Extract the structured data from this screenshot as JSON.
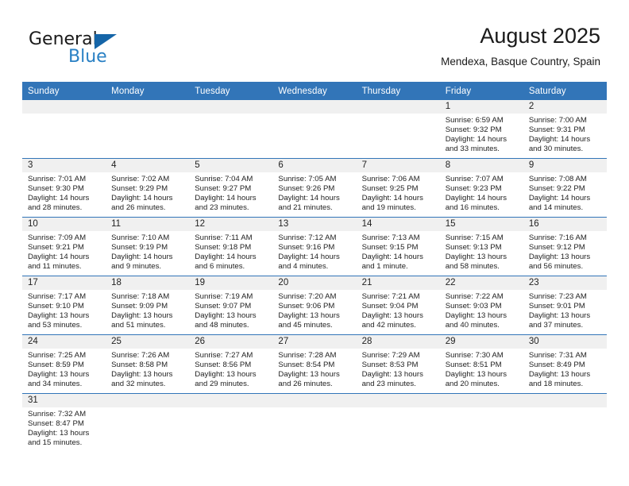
{
  "brand": {
    "name_part1": "General",
    "name_part2": "Blue"
  },
  "header": {
    "title": "August 2025",
    "subtitle": "Mendexa, Basque Country, Spain"
  },
  "calendar": {
    "weekday_headers": [
      "Sunday",
      "Monday",
      "Tuesday",
      "Wednesday",
      "Thursday",
      "Friday",
      "Saturday"
    ],
    "accent_color": "#3275b8",
    "daynum_bg": "#f0f0f0",
    "weeks": [
      [
        {
          "day": "",
          "sunrise": "",
          "sunset": "",
          "daylight_line1": "",
          "daylight_line2": ""
        },
        {
          "day": "",
          "sunrise": "",
          "sunset": "",
          "daylight_line1": "",
          "daylight_line2": ""
        },
        {
          "day": "",
          "sunrise": "",
          "sunset": "",
          "daylight_line1": "",
          "daylight_line2": ""
        },
        {
          "day": "",
          "sunrise": "",
          "sunset": "",
          "daylight_line1": "",
          "daylight_line2": ""
        },
        {
          "day": "",
          "sunrise": "",
          "sunset": "",
          "daylight_line1": "",
          "daylight_line2": ""
        },
        {
          "day": "1",
          "sunrise": "Sunrise: 6:59 AM",
          "sunset": "Sunset: 9:32 PM",
          "daylight_line1": "Daylight: 14 hours",
          "daylight_line2": "and 33 minutes."
        },
        {
          "day": "2",
          "sunrise": "Sunrise: 7:00 AM",
          "sunset": "Sunset: 9:31 PM",
          "daylight_line1": "Daylight: 14 hours",
          "daylight_line2": "and 30 minutes."
        }
      ],
      [
        {
          "day": "3",
          "sunrise": "Sunrise: 7:01 AM",
          "sunset": "Sunset: 9:30 PM",
          "daylight_line1": "Daylight: 14 hours",
          "daylight_line2": "and 28 minutes."
        },
        {
          "day": "4",
          "sunrise": "Sunrise: 7:02 AM",
          "sunset": "Sunset: 9:29 PM",
          "daylight_line1": "Daylight: 14 hours",
          "daylight_line2": "and 26 minutes."
        },
        {
          "day": "5",
          "sunrise": "Sunrise: 7:04 AM",
          "sunset": "Sunset: 9:27 PM",
          "daylight_line1": "Daylight: 14 hours",
          "daylight_line2": "and 23 minutes."
        },
        {
          "day": "6",
          "sunrise": "Sunrise: 7:05 AM",
          "sunset": "Sunset: 9:26 PM",
          "daylight_line1": "Daylight: 14 hours",
          "daylight_line2": "and 21 minutes."
        },
        {
          "day": "7",
          "sunrise": "Sunrise: 7:06 AM",
          "sunset": "Sunset: 9:25 PM",
          "daylight_line1": "Daylight: 14 hours",
          "daylight_line2": "and 19 minutes."
        },
        {
          "day": "8",
          "sunrise": "Sunrise: 7:07 AM",
          "sunset": "Sunset: 9:23 PM",
          "daylight_line1": "Daylight: 14 hours",
          "daylight_line2": "and 16 minutes."
        },
        {
          "day": "9",
          "sunrise": "Sunrise: 7:08 AM",
          "sunset": "Sunset: 9:22 PM",
          "daylight_line1": "Daylight: 14 hours",
          "daylight_line2": "and 14 minutes."
        }
      ],
      [
        {
          "day": "10",
          "sunrise": "Sunrise: 7:09 AM",
          "sunset": "Sunset: 9:21 PM",
          "daylight_line1": "Daylight: 14 hours",
          "daylight_line2": "and 11 minutes."
        },
        {
          "day": "11",
          "sunrise": "Sunrise: 7:10 AM",
          "sunset": "Sunset: 9:19 PM",
          "daylight_line1": "Daylight: 14 hours",
          "daylight_line2": "and 9 minutes."
        },
        {
          "day": "12",
          "sunrise": "Sunrise: 7:11 AM",
          "sunset": "Sunset: 9:18 PM",
          "daylight_line1": "Daylight: 14 hours",
          "daylight_line2": "and 6 minutes."
        },
        {
          "day": "13",
          "sunrise": "Sunrise: 7:12 AM",
          "sunset": "Sunset: 9:16 PM",
          "daylight_line1": "Daylight: 14 hours",
          "daylight_line2": "and 4 minutes."
        },
        {
          "day": "14",
          "sunrise": "Sunrise: 7:13 AM",
          "sunset": "Sunset: 9:15 PM",
          "daylight_line1": "Daylight: 14 hours",
          "daylight_line2": "and 1 minute."
        },
        {
          "day": "15",
          "sunrise": "Sunrise: 7:15 AM",
          "sunset": "Sunset: 9:13 PM",
          "daylight_line1": "Daylight: 13 hours",
          "daylight_line2": "and 58 minutes."
        },
        {
          "day": "16",
          "sunrise": "Sunrise: 7:16 AM",
          "sunset": "Sunset: 9:12 PM",
          "daylight_line1": "Daylight: 13 hours",
          "daylight_line2": "and 56 minutes."
        }
      ],
      [
        {
          "day": "17",
          "sunrise": "Sunrise: 7:17 AM",
          "sunset": "Sunset: 9:10 PM",
          "daylight_line1": "Daylight: 13 hours",
          "daylight_line2": "and 53 minutes."
        },
        {
          "day": "18",
          "sunrise": "Sunrise: 7:18 AM",
          "sunset": "Sunset: 9:09 PM",
          "daylight_line1": "Daylight: 13 hours",
          "daylight_line2": "and 51 minutes."
        },
        {
          "day": "19",
          "sunrise": "Sunrise: 7:19 AM",
          "sunset": "Sunset: 9:07 PM",
          "daylight_line1": "Daylight: 13 hours",
          "daylight_line2": "and 48 minutes."
        },
        {
          "day": "20",
          "sunrise": "Sunrise: 7:20 AM",
          "sunset": "Sunset: 9:06 PM",
          "daylight_line1": "Daylight: 13 hours",
          "daylight_line2": "and 45 minutes."
        },
        {
          "day": "21",
          "sunrise": "Sunrise: 7:21 AM",
          "sunset": "Sunset: 9:04 PM",
          "daylight_line1": "Daylight: 13 hours",
          "daylight_line2": "and 42 minutes."
        },
        {
          "day": "22",
          "sunrise": "Sunrise: 7:22 AM",
          "sunset": "Sunset: 9:03 PM",
          "daylight_line1": "Daylight: 13 hours",
          "daylight_line2": "and 40 minutes."
        },
        {
          "day": "23",
          "sunrise": "Sunrise: 7:23 AM",
          "sunset": "Sunset: 9:01 PM",
          "daylight_line1": "Daylight: 13 hours",
          "daylight_line2": "and 37 minutes."
        }
      ],
      [
        {
          "day": "24",
          "sunrise": "Sunrise: 7:25 AM",
          "sunset": "Sunset: 8:59 PM",
          "daylight_line1": "Daylight: 13 hours",
          "daylight_line2": "and 34 minutes."
        },
        {
          "day": "25",
          "sunrise": "Sunrise: 7:26 AM",
          "sunset": "Sunset: 8:58 PM",
          "daylight_line1": "Daylight: 13 hours",
          "daylight_line2": "and 32 minutes."
        },
        {
          "day": "26",
          "sunrise": "Sunrise: 7:27 AM",
          "sunset": "Sunset: 8:56 PM",
          "daylight_line1": "Daylight: 13 hours",
          "daylight_line2": "and 29 minutes."
        },
        {
          "day": "27",
          "sunrise": "Sunrise: 7:28 AM",
          "sunset": "Sunset: 8:54 PM",
          "daylight_line1": "Daylight: 13 hours",
          "daylight_line2": "and 26 minutes."
        },
        {
          "day": "28",
          "sunrise": "Sunrise: 7:29 AM",
          "sunset": "Sunset: 8:53 PM",
          "daylight_line1": "Daylight: 13 hours",
          "daylight_line2": "and 23 minutes."
        },
        {
          "day": "29",
          "sunrise": "Sunrise: 7:30 AM",
          "sunset": "Sunset: 8:51 PM",
          "daylight_line1": "Daylight: 13 hours",
          "daylight_line2": "and 20 minutes."
        },
        {
          "day": "30",
          "sunrise": "Sunrise: 7:31 AM",
          "sunset": "Sunset: 8:49 PM",
          "daylight_line1": "Daylight: 13 hours",
          "daylight_line2": "and 18 minutes."
        }
      ],
      [
        {
          "day": "31",
          "sunrise": "Sunrise: 7:32 AM",
          "sunset": "Sunset: 8:47 PM",
          "daylight_line1": "Daylight: 13 hours",
          "daylight_line2": "and 15 minutes."
        },
        {
          "day": "",
          "sunrise": "",
          "sunset": "",
          "daylight_line1": "",
          "daylight_line2": ""
        },
        {
          "day": "",
          "sunrise": "",
          "sunset": "",
          "daylight_line1": "",
          "daylight_line2": ""
        },
        {
          "day": "",
          "sunrise": "",
          "sunset": "",
          "daylight_line1": "",
          "daylight_line2": ""
        },
        {
          "day": "",
          "sunrise": "",
          "sunset": "",
          "daylight_line1": "",
          "daylight_line2": ""
        },
        {
          "day": "",
          "sunrise": "",
          "sunset": "",
          "daylight_line1": "",
          "daylight_line2": ""
        },
        {
          "day": "",
          "sunrise": "",
          "sunset": "",
          "daylight_line1": "",
          "daylight_line2": ""
        }
      ]
    ]
  }
}
